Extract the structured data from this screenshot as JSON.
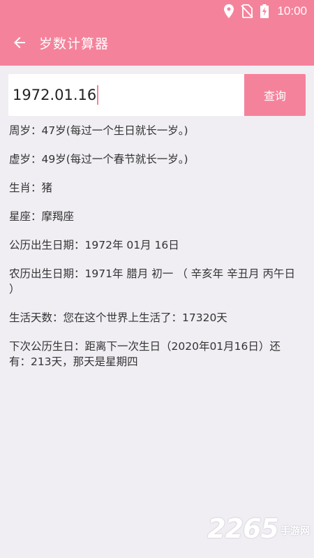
{
  "status_bar": {
    "time": "10:00",
    "icons": [
      "location-icon",
      "no-sim-icon",
      "battery-charging-icon"
    ]
  },
  "app_bar": {
    "back_icon": "arrow-left-icon",
    "title": "岁数计算器"
  },
  "search": {
    "value": "1972.01.16",
    "button_label": "查询"
  },
  "results": [
    "周岁：47岁(每过一个生日就长一岁。)",
    "虚岁：49岁(每过一个春节就长一岁。)",
    "生肖：猪",
    "星座：摩羯座",
    "公历出生日期：1972年 01月 16日",
    "农历出生日期：1971年 腊月 初一 （ 辛亥年 辛丑月 丙午日 ）",
    "生活天数：您在这个世界上生活了：17320天",
    "下次公历生日：距离下一次生日（2020年01月16日）还有：213天，那天是星期四"
  ],
  "watermark": {
    "number": "2265",
    "text": "手游网"
  },
  "colors": {
    "accent": "#f5829b",
    "background": "#f0eef3",
    "text": "#333333"
  }
}
